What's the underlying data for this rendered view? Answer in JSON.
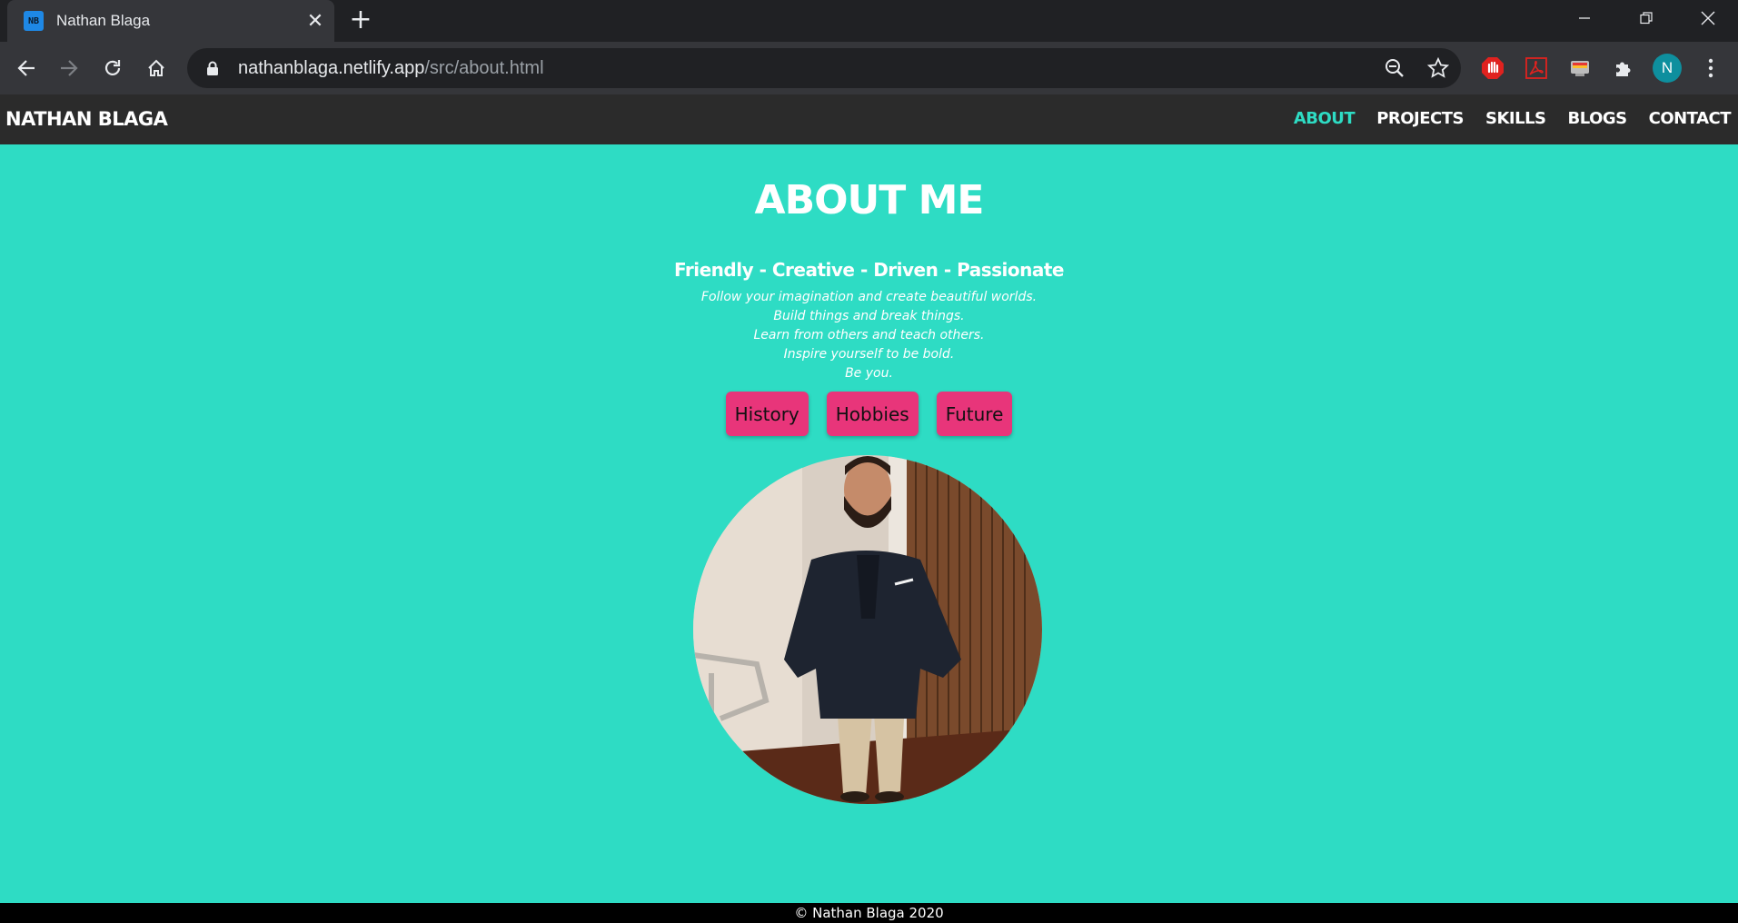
{
  "browser": {
    "tab_title": "Nathan Blaga",
    "favicon_text": "NB",
    "url_host": "nathanblaga.netlify.app",
    "url_path": "/src/about.html",
    "profile_initial": "N"
  },
  "site": {
    "brand": "NATHAN BLAGA",
    "nav": [
      {
        "label": "ABOUT",
        "active": true
      },
      {
        "label": "PROJECTS",
        "active": false
      },
      {
        "label": "SKILLS",
        "active": false
      },
      {
        "label": "BLOGS",
        "active": false
      },
      {
        "label": "CONTACT",
        "active": false
      }
    ],
    "accent_color": "#2edcc4",
    "button_color": "#e8357a"
  },
  "about": {
    "title": "ABOUT ME",
    "tagline": "Friendly - Creative - Driven - Passionate",
    "quotes": [
      "Follow your imagination and create beautiful worlds.",
      "Build things and break things.",
      "Learn from others and teach others.",
      "Inspire yourself to be bold.",
      "Be you."
    ],
    "buttons": [
      "History",
      "Hobbies",
      "Future"
    ]
  },
  "footer": {
    "text": "© Nathan Blaga 2020"
  }
}
